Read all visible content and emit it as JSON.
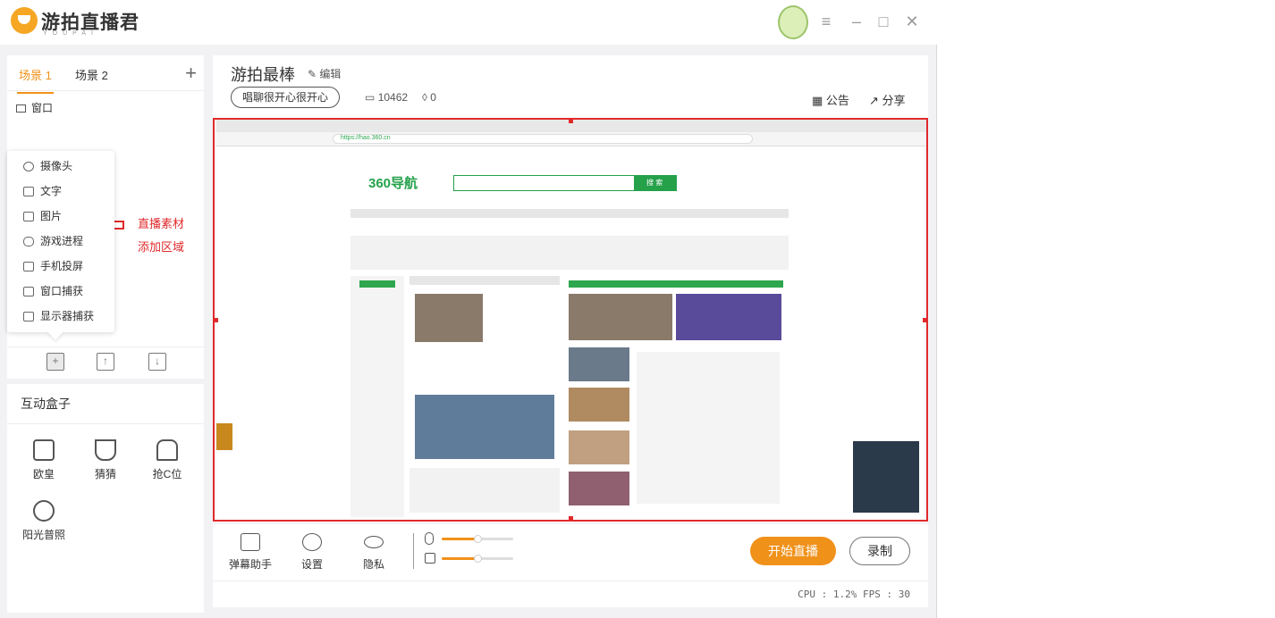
{
  "app": {
    "brand": "游拍直播君",
    "brand_sub": "YOUPAI",
    "accent_color": "#f0911a",
    "highlight_color": "#e0292b"
  },
  "window_controls": {
    "menu_icon": "hamburger-icon",
    "minimize_icon": "minimize-icon",
    "maximize_icon": "maximize-icon",
    "close_icon": "close-icon"
  },
  "scenes": {
    "tabs": [
      {
        "label": "场景 1"
      },
      {
        "label": "场景 2"
      }
    ],
    "add_symbol": "+",
    "sources": [
      {
        "label": "窗口"
      }
    ]
  },
  "add_menu": {
    "items": [
      {
        "label": "摄像头"
      },
      {
        "label": "文字"
      },
      {
        "label": "图片"
      },
      {
        "label": "游戏进程"
      },
      {
        "label": "手机投屏"
      },
      {
        "label": "窗口捕获"
      },
      {
        "label": "显示器捕获"
      }
    ]
  },
  "annotation": {
    "line1": "直播素材",
    "line2": "添加区域"
  },
  "interactive_box": {
    "title": "互动盒子",
    "items": [
      {
        "label": "欧皇"
      },
      {
        "label": "猜猜"
      },
      {
        "label": "抢C位"
      },
      {
        "label": "阳光普照"
      }
    ]
  },
  "stream": {
    "title": "游拍最棒",
    "edit_label": "编辑",
    "tag": "唱聊很开心很开心",
    "room_id": "10462",
    "popularity": "0",
    "notice_label": "公告",
    "share_label": "分享"
  },
  "preview": {
    "url": "https://hao.360.cn",
    "site_logo": "360导航",
    "search_button": "搜 索"
  },
  "controls": {
    "danmaku_label": "弹幕助手",
    "settings_label": "设置",
    "privacy_label": "隐私",
    "mic_volume": 0.5,
    "speaker_volume": 0.5,
    "start_label": "开始直播",
    "record_label": "录制"
  },
  "status": {
    "text": "CPU : 1.2%  FPS : 30"
  }
}
